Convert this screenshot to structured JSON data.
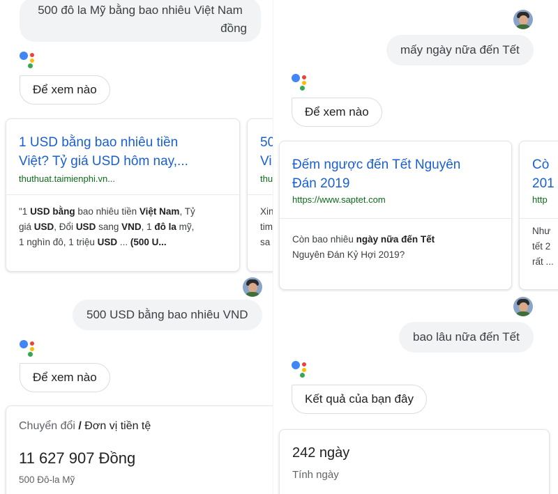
{
  "left": {
    "user_query_1_line1": "500 đô la Mỹ bằng bao nhiêu Việt Nam",
    "user_query_1_line2": "đồng",
    "assistant_reply_1": "Để xem nào",
    "card_1": {
      "title_line1": "1 USD bằng bao nhiêu tiền",
      "title_line2": "Việt? Tỷ giá USD hôm nay,...",
      "url": "thuthuat.taimienphi.vn...",
      "snippet_l1_a": "\"1 ",
      "snippet_l1_b": "USD bằng",
      "snippet_l1_c": " bao nhiêu tiền ",
      "snippet_l1_d": "Việt Nam",
      "snippet_l1_e": ", Tỷ",
      "snippet_l2_a": "giá ",
      "snippet_l2_b": "USD",
      "snippet_l2_c": ", Đổi ",
      "snippet_l2_d": "USD",
      "snippet_l2_e": " sang ",
      "snippet_l2_f": "VND",
      "snippet_l2_g": ", 1 ",
      "snippet_l2_h": "đô la",
      "snippet_l2_i": " mỹ,",
      "snippet_l3_a": "1 nghìn đô, 1 triệu ",
      "snippet_l3_b": "USD",
      "snippet_l3_c": " ... ",
      "snippet_l3_d": "(500 U..."
    },
    "card_2_peek": {
      "title_line1": "50",
      "title_line2": "Vi",
      "url": "thu",
      "snip_l1": "Xin",
      "snip_l2": "tim",
      "snip_l3": "sa"
    },
    "user_query_2": "500 USD bằng bao nhiêu VND",
    "assistant_reply_2": "Để xem nào",
    "converter": {
      "category": "Chuyển đổi",
      "category_sep": " / ",
      "category_sub": "Đơn vị tiền tệ",
      "result": "11 627 907 Đồng",
      "source": "500 Đô-la Mỹ"
    }
  },
  "right": {
    "user_query_1": "mấy ngày nữa đến Tết",
    "assistant_reply_1": "Để xem nào",
    "card_1": {
      "title_line1": "Đếm ngược đến Tết Nguyên",
      "title_line2": "Đán 2019",
      "url": "https://www.saptet.com",
      "snippet_l1_a": "Còn bao nhiêu ",
      "snippet_l1_b": "ngày nữa đến Tết",
      "snippet_l2": "Nguyên Đán Kỷ Hợi 2019?"
    },
    "card_2_peek": {
      "title_line1": "Cò",
      "title_line2": "201",
      "url": "http",
      "snip_l1": "Như",
      "snip_l2": "tết 2",
      "snip_l3": "rất ..."
    },
    "user_query_2": "bao lâu nữa đến Tết",
    "assistant_reply_2": "Kết quả của bạn đây",
    "result": {
      "value": "242 ngày",
      "label": "Tính ngày"
    }
  },
  "icons": {
    "assistant": "google-assistant-icon",
    "avatar": "user-avatar"
  },
  "colors": {
    "link": "#1a5fd0",
    "url": "#0d6b1a",
    "user_bubble": "#f1f3f4",
    "assistant_blue": "#4285f4",
    "assistant_red": "#ea4335",
    "assistant_yellow": "#fbbc05",
    "assistant_green": "#34a853"
  }
}
